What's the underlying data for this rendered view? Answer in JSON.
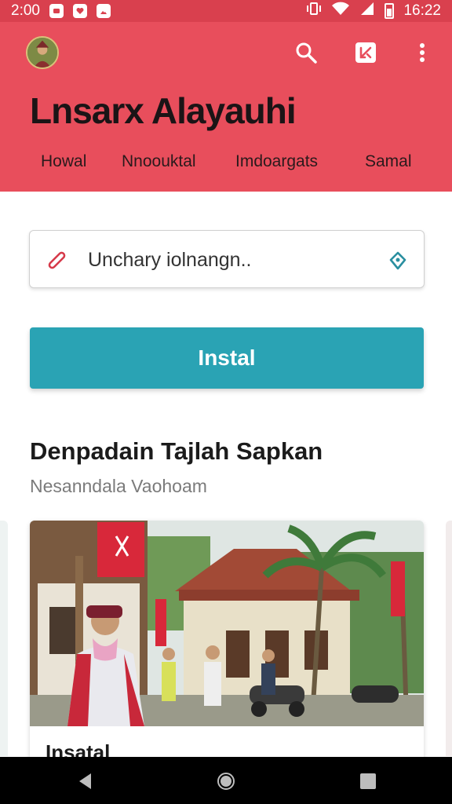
{
  "status_bar": {
    "time": "2:00",
    "right_time": "16:22"
  },
  "header": {
    "title": "Lnsarx Alayauhi",
    "tabs": [
      {
        "label": "Howal"
      },
      {
        "label": "Nnoouktal"
      },
      {
        "label": "Imdoargats"
      },
      {
        "label": "Samal"
      }
    ],
    "actions": [
      "search-icon",
      "shortcut-icon",
      "more-vert-icon"
    ],
    "accent_color": "#e84e5c"
  },
  "search": {
    "placeholder": "Unchary iolnangn.."
  },
  "install_button": {
    "label": "Instal",
    "color": "#2aa3b4"
  },
  "section": {
    "title": "Denpadain Tajlah Sapkan",
    "subtitle": "Nesanndala Vaohoam"
  },
  "card": {
    "label": "Insatal"
  }
}
